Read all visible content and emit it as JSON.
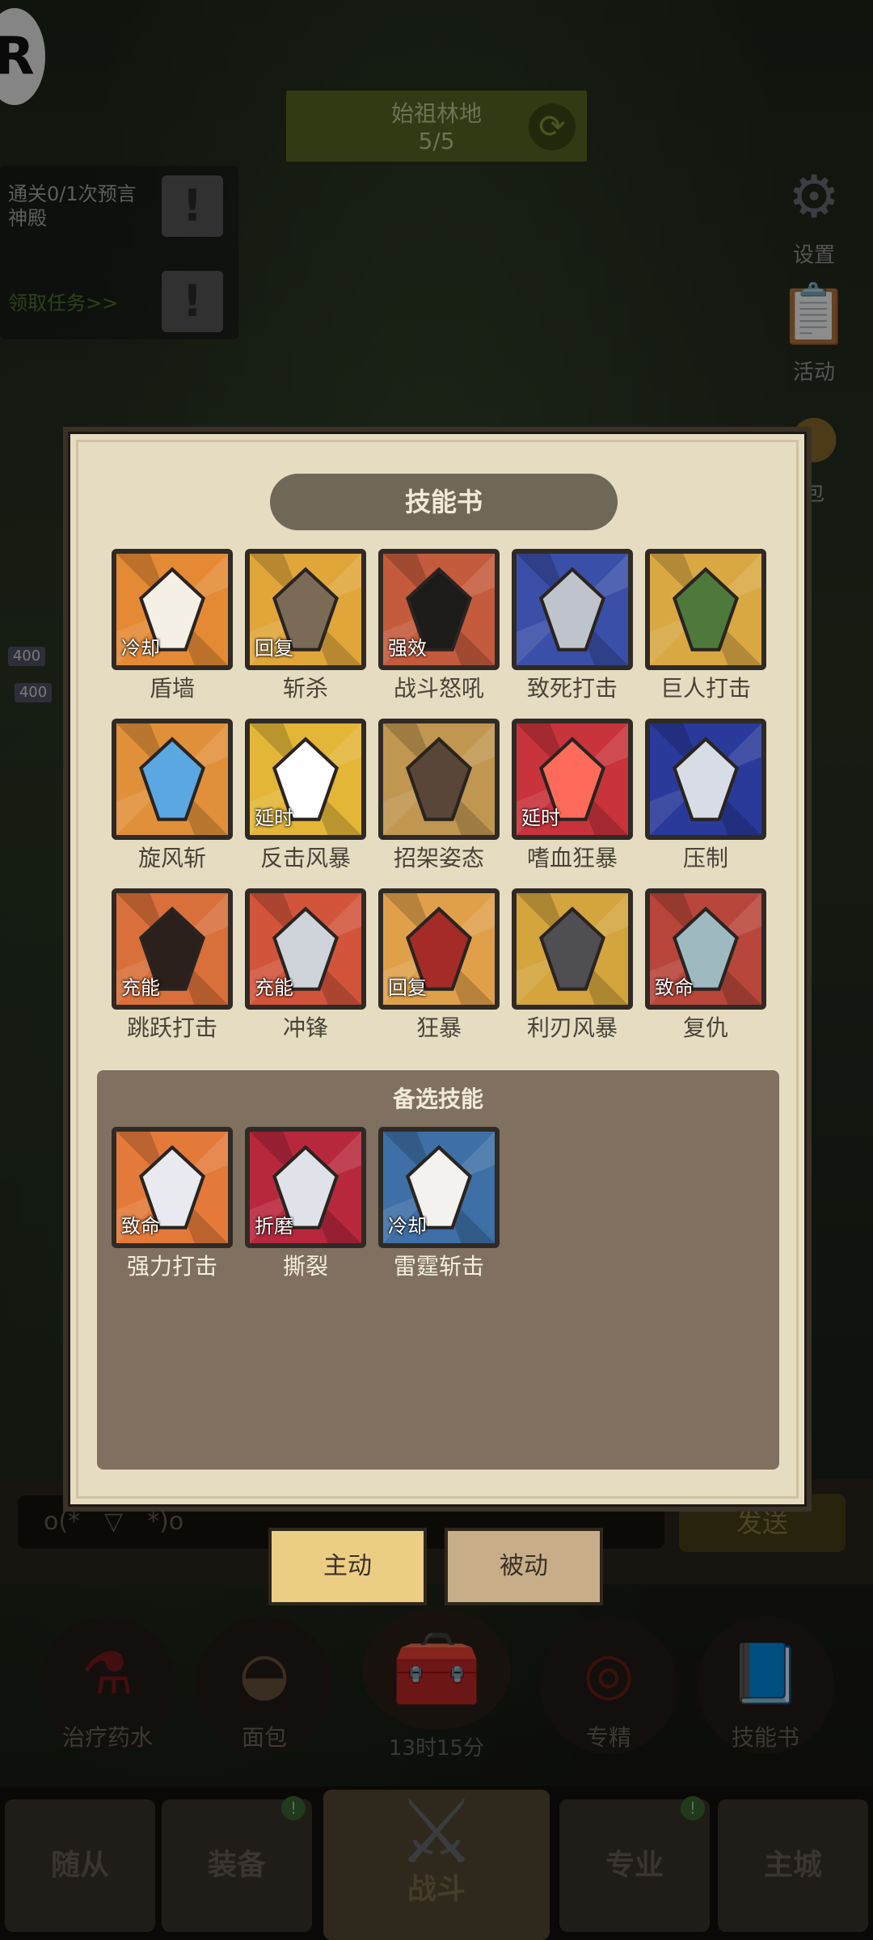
{
  "location": {
    "name": "始祖林地",
    "progress": "5/5"
  },
  "quest": {
    "text": "通关0/1次预言神殿",
    "link": "领取任务>>"
  },
  "side": {
    "settings_label": "设置",
    "activity_label": "活动",
    "bag_label": "包"
  },
  "hp": [
    "400",
    "400"
  ],
  "modal": {
    "title": "技能书",
    "skills": [
      {
        "name": "盾墙",
        "tag": "冷却",
        "colors": [
          "#e58a34",
          "#f5f0e6"
        ]
      },
      {
        "name": "斩杀",
        "tag": "回复",
        "colors": [
          "#e0a63a",
          "#7a6a56"
        ]
      },
      {
        "name": "战斗怒吼",
        "tag": "强效",
        "colors": [
          "#c45b3d",
          "#1c1b1a"
        ]
      },
      {
        "name": "致死打击",
        "tag": "",
        "colors": [
          "#3a4fa8",
          "#bfc4cc"
        ]
      },
      {
        "name": "巨人打击",
        "tag": "",
        "colors": [
          "#d9a843",
          "#4d7a3a"
        ]
      },
      {
        "name": "旋风斩",
        "tag": "",
        "colors": [
          "#e1903a",
          "#5aa7e2"
        ]
      },
      {
        "name": "反击风暴",
        "tag": "延时",
        "colors": [
          "#e3b637",
          "#ffffff"
        ]
      },
      {
        "name": "招架姿态",
        "tag": "",
        "colors": [
          "#c09650",
          "#5a4638"
        ]
      },
      {
        "name": "嗜血狂暴",
        "tag": "延时",
        "colors": [
          "#c9333b",
          "#ff6b5b"
        ]
      },
      {
        "name": "压制",
        "tag": "",
        "colors": [
          "#2a3a9a",
          "#d8dce6"
        ]
      },
      {
        "name": "跳跃打击",
        "tag": "充能",
        "colors": [
          "#d96f3a",
          "#2b1f1c"
        ]
      },
      {
        "name": "冲锋",
        "tag": "充能",
        "colors": [
          "#d2553b",
          "#cfd3da"
        ]
      },
      {
        "name": "狂暴",
        "tag": "回复",
        "colors": [
          "#e0a04a",
          "#a42b27"
        ]
      },
      {
        "name": "利刃风暴",
        "tag": "",
        "colors": [
          "#d4a43d",
          "#4f4e52"
        ]
      },
      {
        "name": "复仇",
        "tag": "致命",
        "colors": [
          "#b8463a",
          "#9fb9c1"
        ]
      }
    ],
    "backup_title": "备选技能",
    "backup_skills": [
      {
        "name": "强力打击",
        "tag": "致命",
        "colors": [
          "#e47a3a",
          "#e8eaf0"
        ]
      },
      {
        "name": "撕裂",
        "tag": "折磨",
        "colors": [
          "#b8283c",
          "#dfe2e8"
        ]
      },
      {
        "name": "雷霆斩击",
        "tag": "冷却",
        "colors": [
          "#3e6fa6",
          "#f4f2ee"
        ]
      }
    ]
  },
  "chat": {
    "placeholder": "o(*￣▽￣*)o",
    "send_label": "发送"
  },
  "tabs": {
    "active": "主动",
    "passive": "被动"
  },
  "consumables": {
    "potion": "治疗药水",
    "bread": "面包",
    "timer": "13时15分",
    "mastery": "专精",
    "skillbook": "技能书"
  },
  "nav": {
    "followers": "随从",
    "equipment": "装备",
    "battle": "战斗",
    "profession": "专业",
    "city": "主城"
  }
}
